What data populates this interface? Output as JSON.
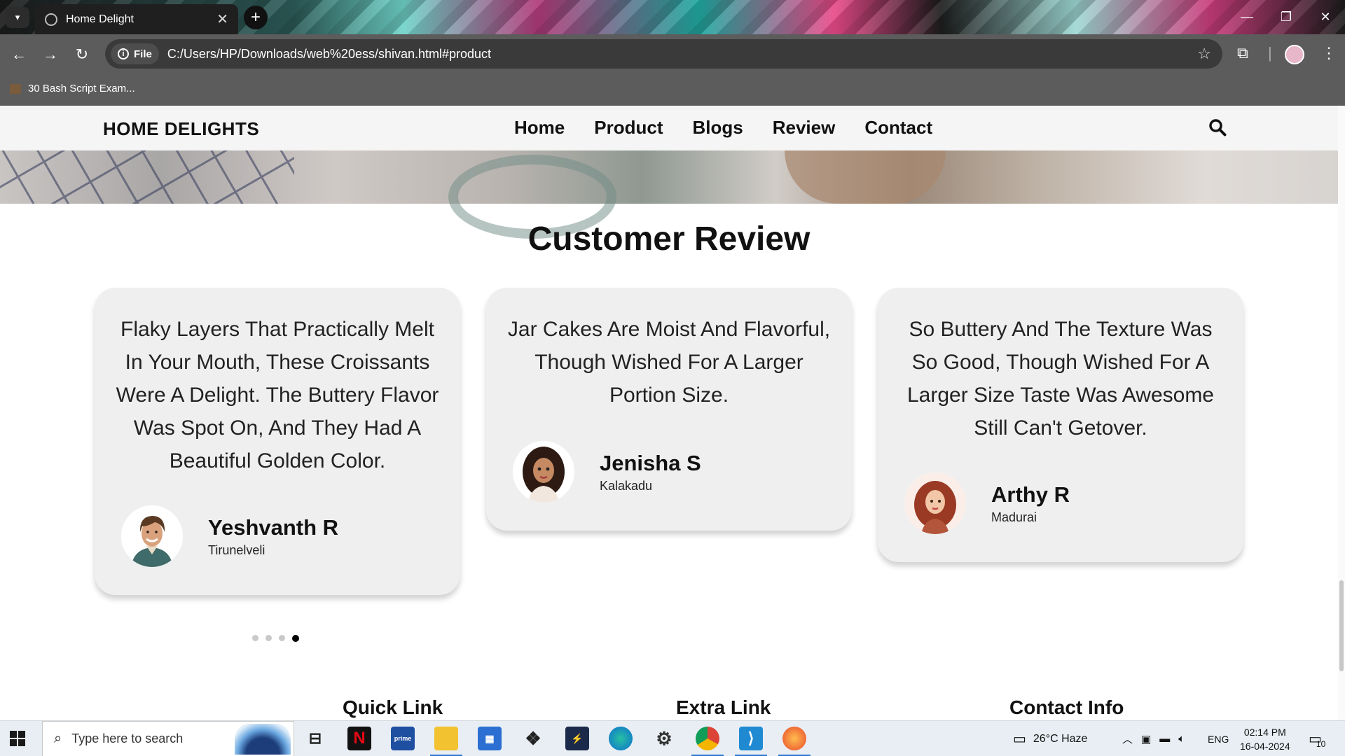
{
  "browser": {
    "tab_title": "Home Delight",
    "url_chip": "File",
    "url": "C:/Users/HP/Downloads/web%20ess/shivan.html#product",
    "bookmark": "30 Bash Script Exam..."
  },
  "site": {
    "logo": "HOME DELIGHTS",
    "nav": [
      "Home",
      "Product",
      "Blogs",
      "Review",
      "Contact"
    ],
    "section_title": "Customer Review",
    "reviews": [
      {
        "quote": "Flaky Layers That Practically Melt In Your Mouth, These Croissants Were A Delight. The Buttery Flavor Was Spot On, And They Had A Beautiful Golden Color.",
        "name": "Yeshvanth R",
        "city": "Tirunelveli",
        "avatar": "man-avatar"
      },
      {
        "quote": "Jar Cakes Are Moist And Flavorful, Though Wished For A Larger Portion Size.",
        "name": "Jenisha S",
        "city": "Kalakadu",
        "avatar": "woman-curly-avatar"
      },
      {
        "quote": "So Buttery And The Texture Was So Good, Though Wished For A Larger Size Taste Was Awesome Still Can't Getover.",
        "name": "Arthy R",
        "city": "Madurai",
        "avatar": "woman-red-hair-avatar"
      }
    ],
    "carousel_dots": 4,
    "active_dot": 4,
    "footer_headings": [
      "Quick Link",
      "Extra Link",
      "Contact Info"
    ]
  },
  "taskbar": {
    "search_placeholder": "Type here to search",
    "weather": "26°C  Haze",
    "language": "ENG",
    "time": "02:14 PM",
    "date": "16-04-2024",
    "notifications": "10",
    "apps": [
      "task-view",
      "netflix",
      "prime-video",
      "file-explorer",
      "microsoft-store",
      "dropbox",
      "powershell",
      "edge",
      "settings",
      "chrome",
      "vscode",
      "firefox"
    ]
  },
  "colors": {
    "card_bg": "#efefef",
    "nav_bg": "#f5f5f5",
    "browser_toolbar": "#5c5c5c"
  }
}
